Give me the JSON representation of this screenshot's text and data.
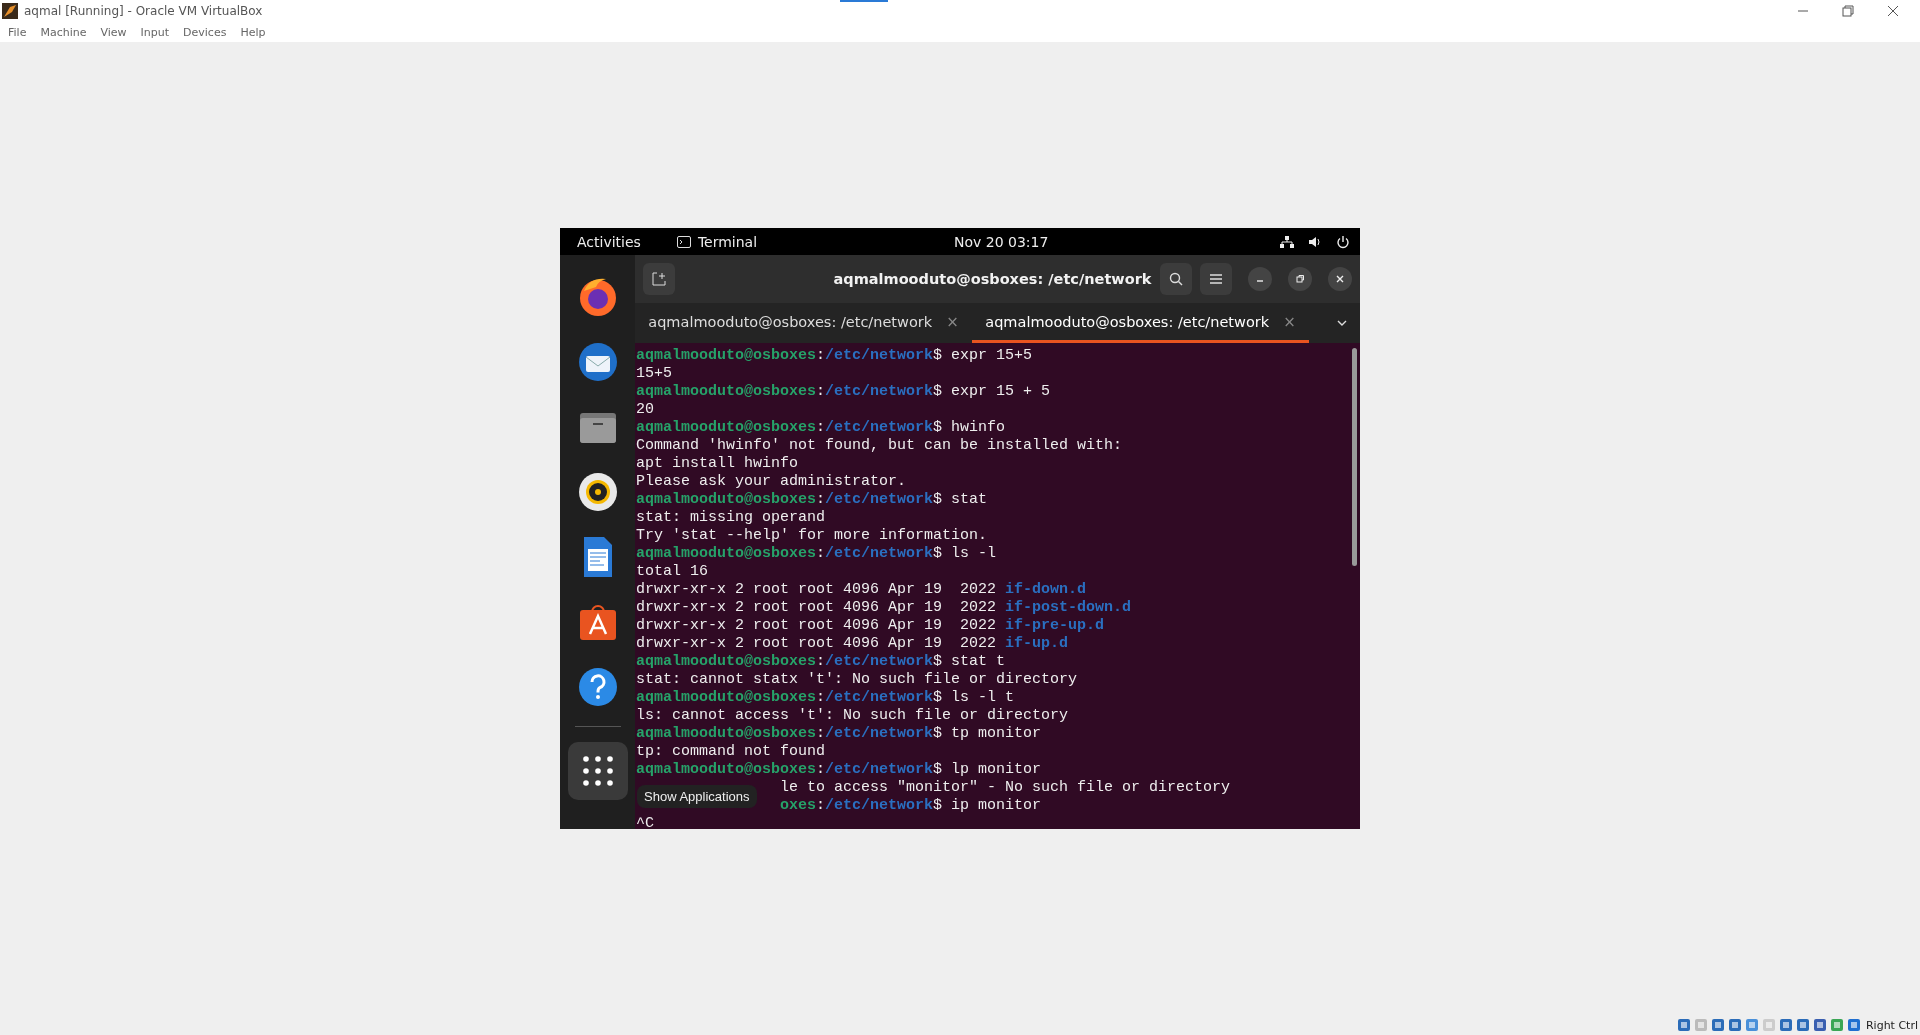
{
  "window": {
    "title": "aqmal [Running] - Oracle VM VirtualBox"
  },
  "menu": [
    "File",
    "Machine",
    "View",
    "Input",
    "Devices",
    "Help"
  ],
  "guest": {
    "top_bar": {
      "activities": "Activities",
      "app": "Terminal",
      "clock": "Nov 20  03:17"
    },
    "dock": {
      "tooltip": "Show Applications"
    },
    "terminal": {
      "title": "aqmalmooduto@osboxes: /etc/network",
      "tabs": [
        {
          "label": "aqmalmooduto@osboxes: /etc/network",
          "close": "×",
          "selected": false
        },
        {
          "label": "aqmalmooduto@osboxes: /etc/network",
          "close": "×",
          "selected": true
        }
      ],
      "lines": [
        {
          "kind": "prompt",
          "user": "aqmalmooduto@osboxes",
          "sep": ":",
          "path": "/etc/network",
          "command": "$ expr 15+5"
        },
        {
          "kind": "output",
          "text": "15+5"
        },
        {
          "kind": "prompt",
          "user": "aqmalmooduto@osboxes",
          "sep": ":",
          "path": "/etc/network",
          "command": "$ expr 15 + 5"
        },
        {
          "kind": "output",
          "text": "20"
        },
        {
          "kind": "prompt",
          "user": "aqmalmooduto@osboxes",
          "sep": ":",
          "path": "/etc/network",
          "command": "$ hwinfo"
        },
        {
          "kind": "output",
          "text": "Command 'hwinfo' not found, but can be installed with:"
        },
        {
          "kind": "output",
          "text": "apt install hwinfo"
        },
        {
          "kind": "output",
          "text": "Please ask your administrator."
        },
        {
          "kind": "prompt",
          "user": "aqmalmooduto@osboxes",
          "sep": ":",
          "path": "/etc/network",
          "command": "$ stat"
        },
        {
          "kind": "output",
          "text": "stat: missing operand"
        },
        {
          "kind": "output",
          "text": "Try 'stat --help' for more information."
        },
        {
          "kind": "prompt",
          "user": "aqmalmooduto@osboxes",
          "sep": ":",
          "path": "/etc/network",
          "command": "$ ls -l"
        },
        {
          "kind": "output",
          "text": "total 16"
        },
        {
          "kind": "listing",
          "text": "drwxr-xr-x 2 root root 4096 Apr 19  2022",
          "name": "if-down.d"
        },
        {
          "kind": "listing",
          "text": "drwxr-xr-x 2 root root 4096 Apr 19  2022",
          "name": "if-post-down.d"
        },
        {
          "kind": "listing",
          "text": "drwxr-xr-x 2 root root 4096 Apr 19  2022",
          "name": "if-pre-up.d"
        },
        {
          "kind": "listing",
          "text": "drwxr-xr-x 2 root root 4096 Apr 19  2022",
          "name": "if-up.d"
        },
        {
          "kind": "prompt",
          "user": "aqmalmooduto@osboxes",
          "sep": ":",
          "path": "/etc/network",
          "command": "$ stat t"
        },
        {
          "kind": "output",
          "text": "stat: cannot statx 't': No such file or directory"
        },
        {
          "kind": "prompt",
          "user": "aqmalmooduto@osboxes",
          "sep": ":",
          "path": "/etc/network",
          "command": "$ ls -l t"
        },
        {
          "kind": "output",
          "text": "ls: cannot access 't': No such file or directory"
        },
        {
          "kind": "prompt",
          "user": "aqmalmooduto@osboxes",
          "sep": ":",
          "path": "/etc/network",
          "command": "$ tp monitor"
        },
        {
          "kind": "output",
          "text": "tp: command not found"
        },
        {
          "kind": "prompt",
          "user": "aqmalmooduto@osboxes",
          "sep": ":",
          "path": "/etc/network",
          "command": "$ lp monitor"
        },
        {
          "kind": "covered_output",
          "text": "le to access \"monitor\" - No such file or directory"
        },
        {
          "kind": "covered_prompt",
          "user": "oxes",
          "sep": ":",
          "path": "/etc/network",
          "command": "$ ip monitor"
        },
        {
          "kind": "output",
          "text": "^C"
        }
      ]
    }
  },
  "status_bar": {
    "host_key": "Right Ctrl"
  }
}
